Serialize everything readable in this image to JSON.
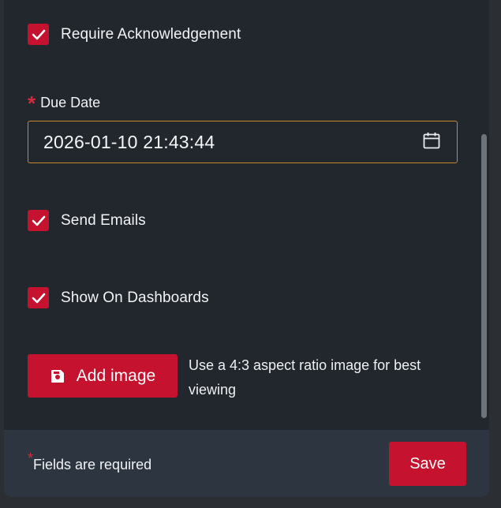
{
  "form": {
    "require_ack": {
      "label": "Require Acknowledgement",
      "checked": true
    },
    "due_date": {
      "label": "Due Date",
      "required_marker": "*",
      "value": "2026-01-10 21:43:44",
      "icon": "calendar-icon"
    },
    "send_emails": {
      "label": "Send Emails",
      "checked": true
    },
    "show_on_dashboards": {
      "label": "Show On Dashboards",
      "checked": true
    },
    "add_image": {
      "label": "Add image",
      "icon": "image-upload-icon",
      "hint": "Use a 4:3 aspect ratio image for best viewing"
    }
  },
  "footer": {
    "required_marker": "*",
    "required_note": "Fields are required",
    "save_label": "Save"
  },
  "colors": {
    "accent": "#c4122f",
    "panel_bg": "#22272d",
    "footer_bg": "#2d3640",
    "input_border": "#c88a2b",
    "required": "#d52a3c"
  }
}
